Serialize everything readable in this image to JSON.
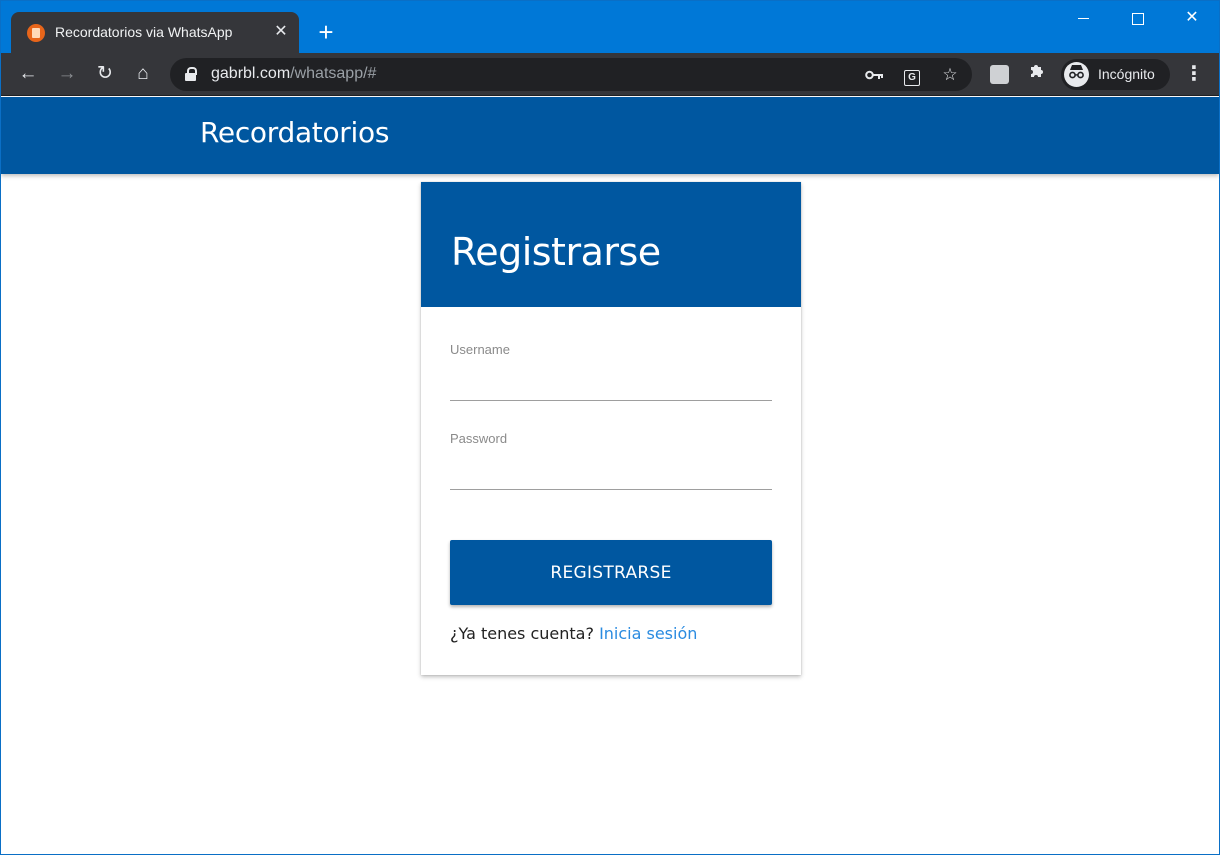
{
  "browser": {
    "tab": {
      "title": "Recordatorios via WhatsApp",
      "close_glyph": "✕"
    },
    "new_tab_glyph": "+",
    "window_controls": {
      "close_glyph": "✕"
    },
    "toolbar": {
      "back_glyph": "←",
      "forward_glyph": "→",
      "reload_glyph": "↻",
      "home_glyph": "⌂",
      "url_host": "gabrbl.com",
      "url_path": "/whatsapp/#",
      "star_glyph": "☆",
      "puzzle_glyph": "✱",
      "menu_glyph": "⋮",
      "incognito_label": "Incógnito"
    }
  },
  "app": {
    "header_title": "Recordatorios",
    "card": {
      "title": "Registrarse",
      "username_label": "Username",
      "password_label": "Password",
      "submit_label": "REGISTRARSE",
      "login_prompt": "¿Ya tenes cuenta?",
      "login_link": "Inicia sesión"
    }
  },
  "colors": {
    "chrome_blue": "#0078d7",
    "app_primary": "#0057a0",
    "link": "#2a8be0"
  }
}
